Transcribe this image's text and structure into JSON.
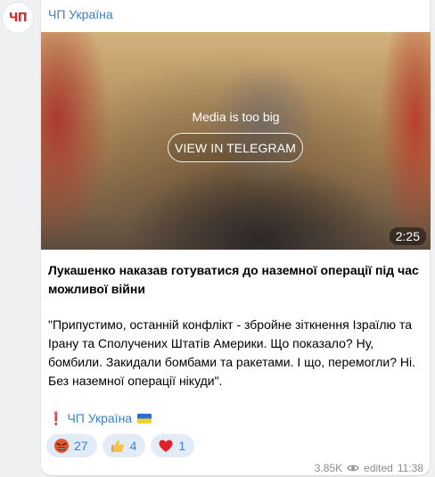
{
  "channel": {
    "name": "ЧП Україна",
    "avatar_text": "ЧП"
  },
  "media": {
    "notice": "Media is too big",
    "button_label": "VIEW IN TELEGRAM",
    "duration": "2:25"
  },
  "post": {
    "headline": "Лукашенко наказав готуватися до наземної операції під час можливої війни",
    "quote": "\"Припустимо, останній конфлікт - збройне зіткнення Ізраїлю та Ірану та Сполучених Штатів Америки. Що показало? Ну, бомбили. Закидали бомбами та ракетами. І що, перемогли? Ні. Без наземної операції нікуди\".",
    "signature_mark": "❗",
    "signature_link": "ЧП Україна"
  },
  "reactions": [
    {
      "icon": "angry-face-icon",
      "count": "27"
    },
    {
      "icon": "thumbs-up-icon",
      "count": "4"
    },
    {
      "icon": "red-heart-icon",
      "count": "1"
    }
  ],
  "meta": {
    "views": "3.85K",
    "status": "edited",
    "time": "11:38"
  },
  "colors": {
    "accent": "#3a82c5",
    "brand_red": "#e0242b",
    "reaction_bg": "#e3ecf6"
  }
}
